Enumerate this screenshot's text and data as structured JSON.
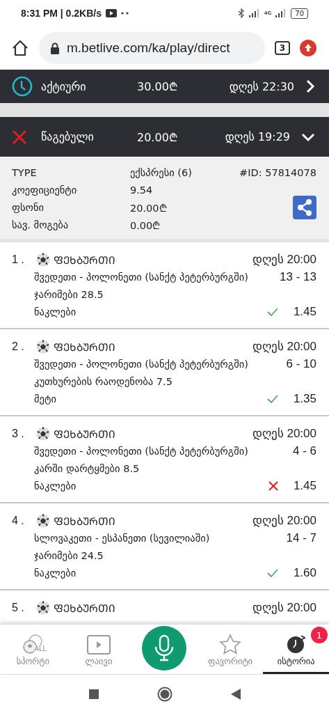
{
  "status_bar": {
    "time": "8:31 PM | 0.2KB/s",
    "network": "4G",
    "battery": "70"
  },
  "browser": {
    "url": "m.betlive.com/ka/play/direct",
    "tab_count": "3"
  },
  "bets": [
    {
      "kind": "active",
      "status": "აქტიური",
      "amount": "30.00₾",
      "time": "დღეს 22:30",
      "expanded": false
    },
    {
      "kind": "lost",
      "status": "წაგებული",
      "amount": "20.00₾",
      "time": "დღეს 19:29",
      "expanded": true
    }
  ],
  "details": {
    "type_label": "TYPE",
    "type_value": "ექსპრესი (6)",
    "id": "#ID: 57814078",
    "rows": [
      {
        "label": "კოეფიციენტი",
        "value": "9.54"
      },
      {
        "label": "ფსონი",
        "value": "20.00₾"
      },
      {
        "label": "სავ. მოგება",
        "value": "0.00₾"
      }
    ]
  },
  "selections": [
    {
      "number": "1 .",
      "sport": "ᲤᲔᲮᲑᲣᲠᲗᲘ",
      "time": "დღეს 20:00",
      "match": "შვედეთი - პოლონეთი (სანქტ პეტერბურგში)",
      "score": "13 - 13",
      "market": "ჯარიმები 28.5",
      "pick": "ნაკლები",
      "won": true,
      "odds": "1.45"
    },
    {
      "number": "2 .",
      "sport": "ᲤᲔᲮᲑᲣᲠᲗᲘ",
      "time": "დღეს 20:00",
      "match": "შვედეთი - პოლონეთი (სანქტ პეტერბურგში)",
      "score": "6 - 10",
      "market": "კუთხურების რაოდენობა 7.5",
      "pick": "მეტი",
      "won": true,
      "odds": "1.35"
    },
    {
      "number": "3 .",
      "sport": "ᲤᲔᲮᲑᲣᲠᲗᲘ",
      "time": "დღეს 20:00",
      "match": "შვედეთი - პოლონეთი (სანქტ პეტერბურგში)",
      "score": "4 - 6",
      "market": "კარში დარტყმები 8.5",
      "pick": "ნაკლები",
      "won": false,
      "odds": "1.45"
    },
    {
      "number": "4 .",
      "sport": "ᲤᲔᲮᲑᲣᲠᲗᲘ",
      "time": "დღეს 20:00",
      "match": "სლოვაკეთი - ესპანეთი (სევილიაში)",
      "score": "14 - 7",
      "market": "ჯარიმები 24.5",
      "pick": "ნაკლები",
      "won": true,
      "odds": "1.60"
    },
    {
      "number": "5 .",
      "sport": "ᲤᲔᲮᲑᲣᲠᲗᲘ",
      "time": "დღეს 20:00"
    }
  ],
  "bottom_nav": [
    {
      "kind": "sports",
      "label": "სპორტი",
      "icon_text": "ALL",
      "selected": false
    },
    {
      "kind": "live",
      "label": "ლაივი",
      "selected": false
    },
    {
      "kind": "mic"
    },
    {
      "kind": "favorites",
      "label": "ფავორიტი",
      "selected": false
    },
    {
      "kind": "history",
      "label": "ისტორია",
      "selected": true,
      "badge": "1"
    }
  ]
}
